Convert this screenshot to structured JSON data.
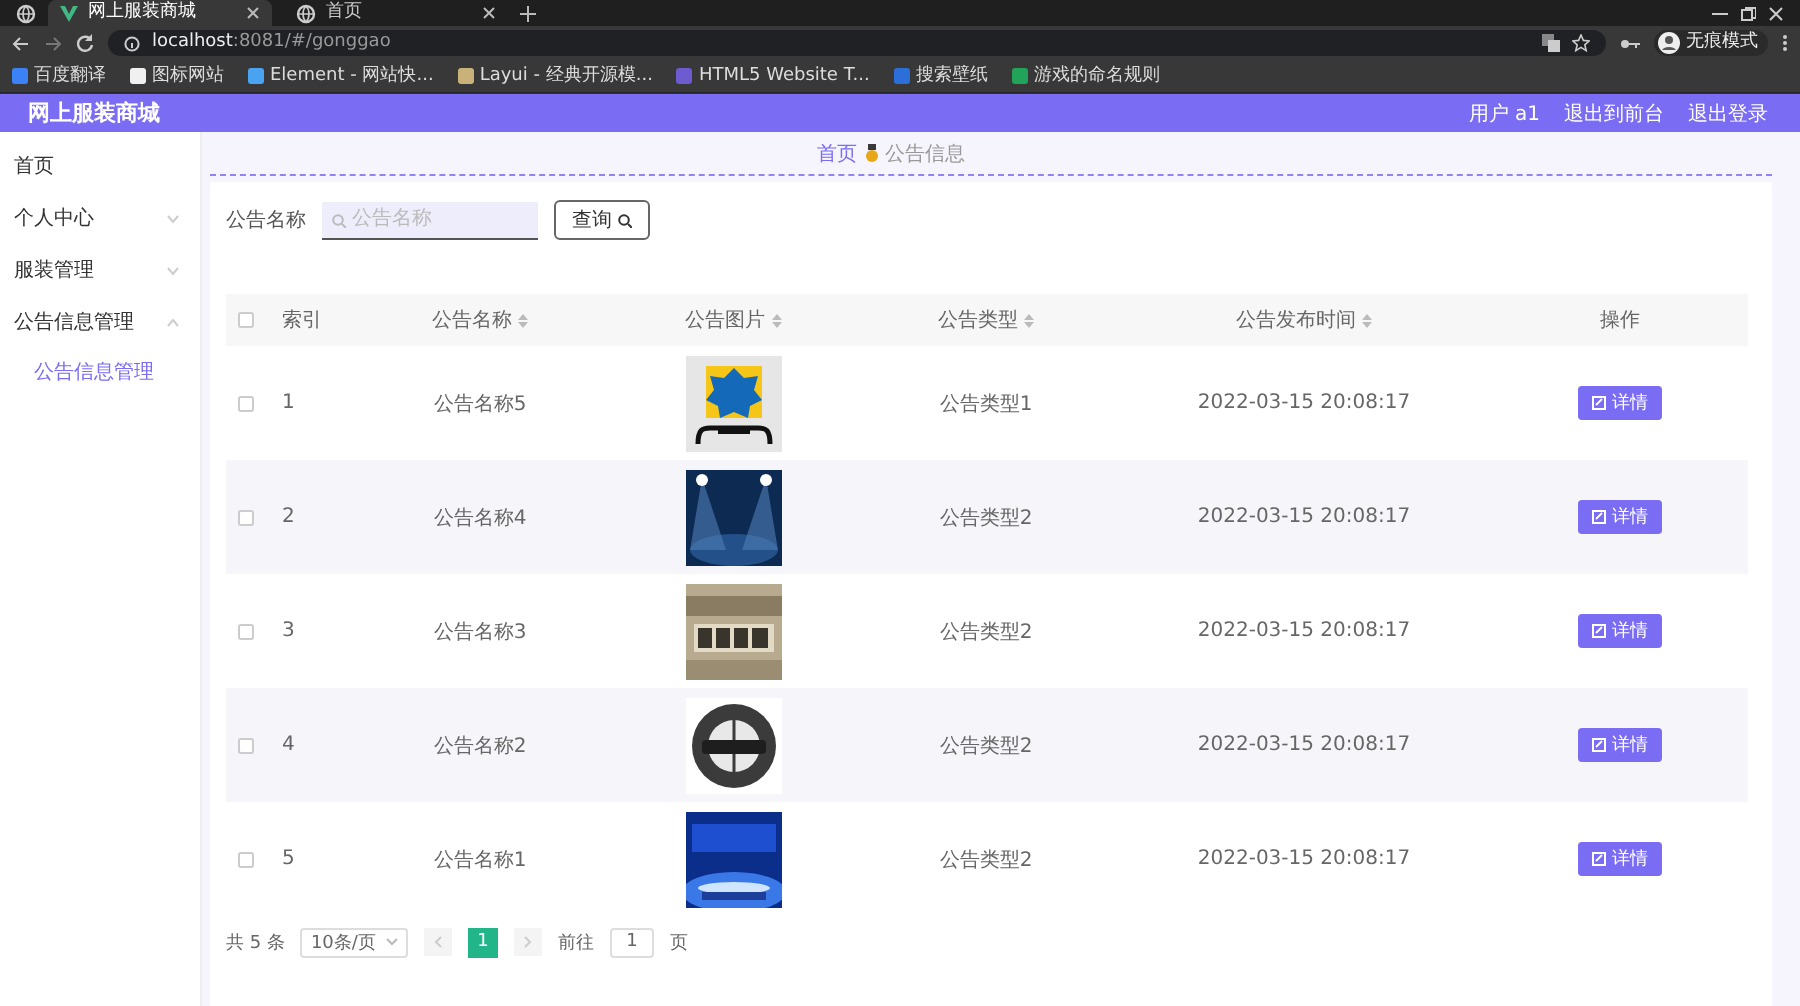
{
  "browser": {
    "tabs": [
      {
        "title": "网上服装商城",
        "selected": true
      },
      {
        "title": "首页",
        "selected": false
      }
    ],
    "url_host": "localhost",
    "url_path": ":8081/#/gonggao",
    "bookmarks": [
      "百度翻译",
      "图标网站",
      "Element - 网站快...",
      "Layui - 经典开源模...",
      "HTML5 Website T...",
      "搜索壁纸",
      "游戏的命名规则"
    ],
    "profile": "无痕模式"
  },
  "app": {
    "title": "网上服装商城",
    "user": "用户 a1",
    "links": [
      "退出到前台",
      "退出登录"
    ]
  },
  "sidebar": {
    "items": [
      {
        "label": "首页"
      },
      {
        "label": "个人中心",
        "expanded": false
      },
      {
        "label": "服装管理",
        "expanded": false
      },
      {
        "label": "公告信息管理",
        "expanded": true,
        "children": [
          {
            "label": "公告信息管理",
            "selected": true
          }
        ]
      }
    ]
  },
  "breadcrumb": [
    "首页",
    "公告信息"
  ],
  "search": {
    "label": "公告名称",
    "placeholder": "公告名称",
    "button": "查询"
  },
  "table": {
    "all_checked": false,
    "columns": [
      {
        "label": "索引",
        "sortable": false
      },
      {
        "label": "公告名称",
        "sortable": true
      },
      {
        "label": "公告图片",
        "sortable": true
      },
      {
        "label": "公告类型",
        "sortable": true
      },
      {
        "label": "公告发布时间",
        "sortable": true
      },
      {
        "label": "操作",
        "sortable": false
      }
    ],
    "rows": [
      {
        "checked": false,
        "index": "1",
        "name": "公告名称5",
        "type": "公告类型1",
        "time": "2022-03-15 20:08:17",
        "action": "详情"
      },
      {
        "checked": false,
        "index": "2",
        "name": "公告名称4",
        "type": "公告类型2",
        "time": "2022-03-15 20:08:17",
        "action": "详情"
      },
      {
        "checked": false,
        "index": "3",
        "name": "公告名称3",
        "type": "公告类型2",
        "time": "2022-03-15 20:08:17",
        "action": "详情"
      },
      {
        "checked": false,
        "index": "4",
        "name": "公告名称2",
        "type": "公告类型2",
        "time": "2022-03-15 20:08:17",
        "action": "详情"
      },
      {
        "checked": false,
        "index": "5",
        "name": "公告名称1",
        "type": "公告类型2",
        "time": "2022-03-15 20:08:17",
        "action": "详情"
      }
    ]
  },
  "pagination": {
    "total": "共 5 条",
    "page_size": "10条/页",
    "pages": [
      {
        "label": "1",
        "selected": true
      }
    ],
    "goto_label": "前往",
    "goto_value": "1",
    "goto_suffix": "页"
  }
}
